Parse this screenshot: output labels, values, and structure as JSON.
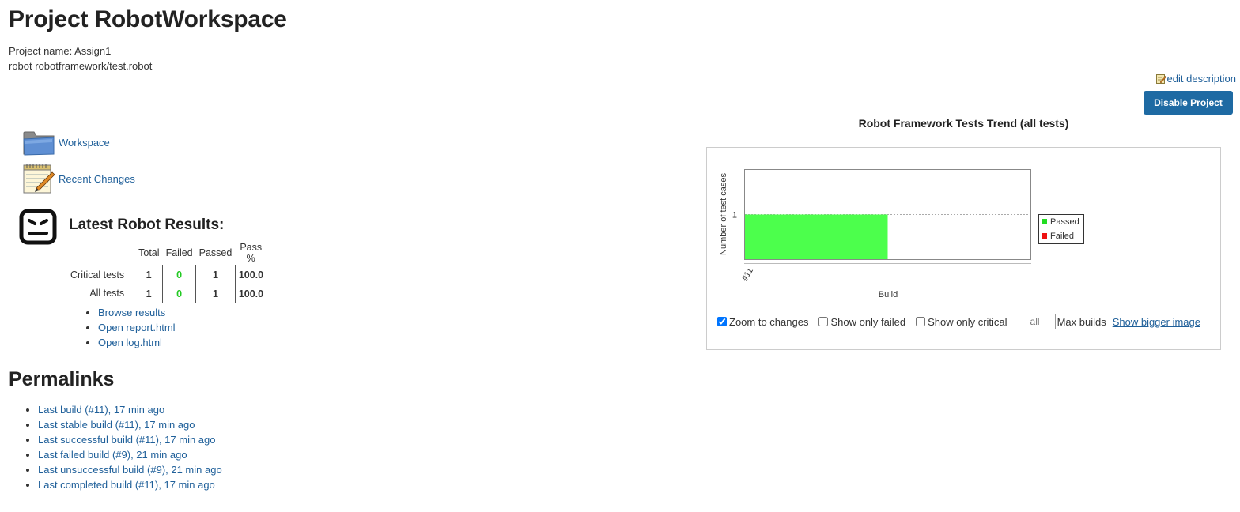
{
  "header": {
    "title": "Project RobotWorkspace",
    "description_lines": [
      "Project name: Assign1",
      "robot robotframework/test.robot"
    ],
    "edit_description": "edit description",
    "disable_button": "Disable Project"
  },
  "sidebar": {
    "items": [
      {
        "label": "Workspace",
        "icon": "folder-icon"
      },
      {
        "label": "Recent Changes",
        "icon": "notepad-icon"
      }
    ]
  },
  "robot_results": {
    "title": "Latest Robot Results:",
    "columns": [
      "Total",
      "Failed",
      "Passed",
      "Pass %"
    ],
    "rows": [
      {
        "label": "Critical tests",
        "total": "1",
        "failed": "0",
        "passed": "1",
        "pass_pct": "100.0"
      },
      {
        "label": "All tests",
        "total": "1",
        "failed": "0",
        "passed": "1",
        "pass_pct": "100.0"
      }
    ],
    "links": [
      "Browse results",
      "Open report.html",
      "Open log.html"
    ]
  },
  "permalinks": {
    "title": "Permalinks",
    "items": [
      "Last build (#11), 17 min ago",
      "Last stable build (#11), 17 min ago",
      "Last successful build (#11), 17 min ago",
      "Last failed build (#9), 21 min ago",
      "Last unsuccessful build (#9), 21 min ago",
      "Last completed build (#11), 17 min ago"
    ]
  },
  "trend": {
    "title": "Robot Framework Tests Trend (all tests)",
    "controls": {
      "zoom_to_changes": "Zoom to changes",
      "zoom_checked": true,
      "show_only_failed": "Show only failed",
      "show_only_critical": "Show only critical",
      "max_builds_value": "all",
      "max_builds_label": "Max builds",
      "show_bigger": "Show bigger image"
    }
  },
  "chart_data": {
    "type": "area",
    "title": "",
    "xlabel": "Build",
    "ylabel": "Number of test cases",
    "categories": [
      "#11"
    ],
    "series": [
      {
        "name": "Passed",
        "values": [
          1
        ],
        "color": "#4cff4c"
      },
      {
        "name": "Failed",
        "values": [
          0
        ],
        "color": "#ee1111"
      }
    ],
    "y_ticks": [
      "1"
    ],
    "legend": "right"
  }
}
